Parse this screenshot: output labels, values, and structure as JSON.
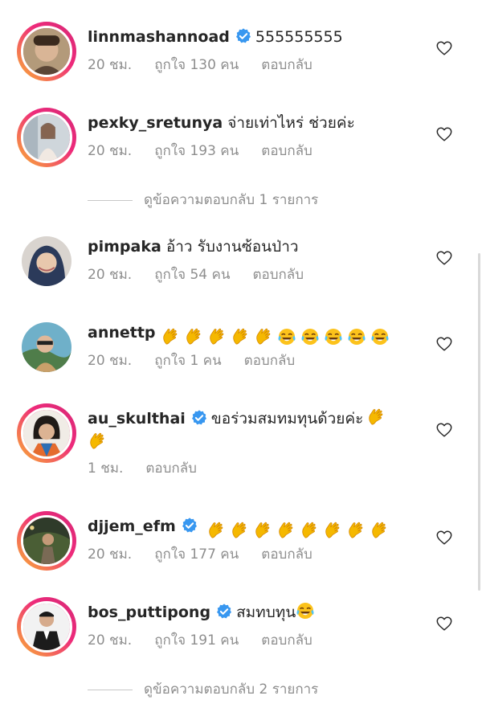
{
  "comments": [
    {
      "username": "linnmashannoad",
      "verified": true,
      "text": "555555555",
      "time": "20 ชม.",
      "likes": "ถูกใจ 130 คน",
      "reply": "ตอบกลับ"
    },
    {
      "username": "pexky_sretunya",
      "verified": false,
      "text": "จ่ายเท่าไหร่ ช่วยค่ะ",
      "time": "20 ชม.",
      "likes": "ถูกใจ 193 คน",
      "reply": "ตอบกลับ",
      "view_replies": "ดูข้อความตอบกลับ 1 รายการ"
    },
    {
      "username": "pimpaka",
      "verified": false,
      "text": "อ้าว รับงานซ้อนป่าว",
      "time": "20 ชม.",
      "likes": "ถูกใจ 54 คน",
      "reply": "ตอบกลับ"
    },
    {
      "username": "annettp",
      "verified": false,
      "emoji": "5 clapping-hands, 5 tears-of-joy",
      "time": "20 ชม.",
      "likes": "ถูกใจ 1 คน",
      "reply": "ตอบกลับ"
    },
    {
      "username": "au_skulthai",
      "verified": true,
      "text": "ขอร่วมสมทมทุนด้วยค่ะ",
      "emoji": "clapping-hands",
      "time": "1 ชม.",
      "reply": "ตอบกลับ"
    },
    {
      "username": "djjem_efm",
      "verified": true,
      "emoji": "8 clapping-hands",
      "time": "20 ชม.",
      "likes": "ถูกใจ 177 คน",
      "reply": "ตอบกลับ"
    },
    {
      "username": "bos_puttipong",
      "verified": true,
      "text": "สมทบทุน",
      "emoji": "tears-of-joy",
      "time": "20 ชม.",
      "likes": "ถูกใจ 191 คน",
      "reply": "ตอบกลับ",
      "view_replies": "ดูข้อความตอบกลับ 2 รายการ"
    }
  ],
  "colors": {
    "verified": "#3897f0",
    "meta": "#8e8e8e",
    "story_ring_start": "#f9b233",
    "story_ring_end": "#d62976"
  },
  "icons": {
    "like": "heart-outline-icon",
    "verified": "verified-badge-icon"
  }
}
